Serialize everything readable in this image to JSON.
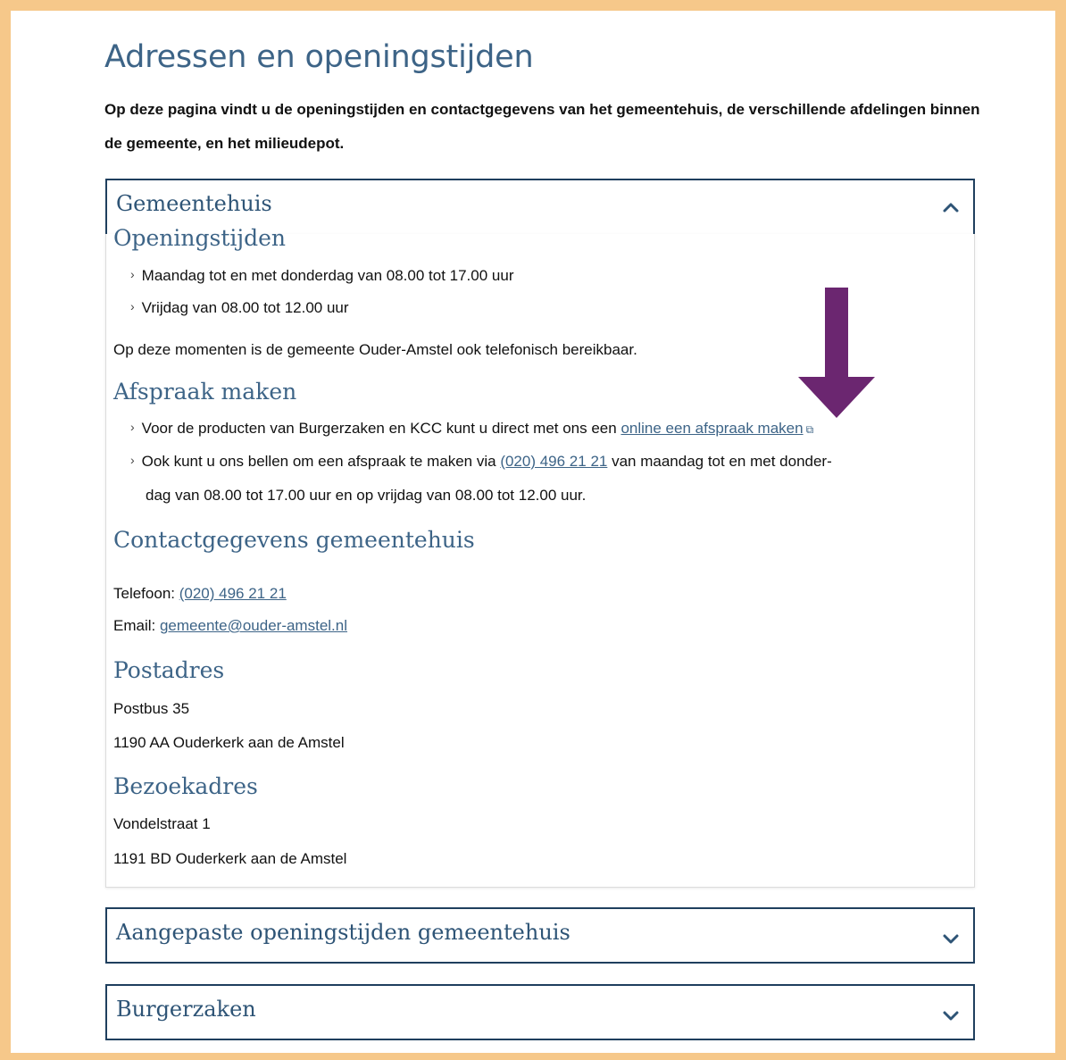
{
  "page_title": "Adressen en openingstijden",
  "intro": "Op deze pagina vindt u de openingstijden en contactgegevens van het gemeentehuis, de verschillende afdelingen binnen de gemeente, en het milieudepot.",
  "accordion_open": {
    "title": "Gemeentehuis",
    "sections": {
      "openingstijden_heading": "Openingstijden",
      "openingstijden_items": [
        "Maandag tot en met donderdag van 08.00 tot 17.00 uur",
        "Vrijdag van 08.00 tot 12.00 uur"
      ],
      "phone_note": "Op deze momenten is de gemeente Ouder-Amstel ook telefonisch bereikbaar.",
      "afspraak_heading": "Afspraak maken",
      "afspraak_item1_text": "Voor de producten van Burgerzaken en KCC kunt u direct met ons een",
      "afspraak_item1_link": "online een afspraak maken",
      "afspraak_item2_pre": "Ook kunt u ons bellen om een afspraak te maken via",
      "afspraak_item2_link": "(020) 496 21 21",
      "afspraak_item2_post": "van maandag tot en met donder-",
      "afspraak_item2_line2": "dag van 08.00 tot 17.00 uur en op vrijdag van 08.00 tot 12.00 uur.",
      "contact_heading": "Contactgegevens gemeentehuis",
      "telefoon_label": "Telefoon:",
      "telefoon_value": "(020) 496 21 21",
      "email_label": "Email:",
      "email_value": "gemeente@ouder-amstel.nl",
      "postadres_heading": "Postadres",
      "postadres_line1": "Postbus 35",
      "postadres_line2": "1190 AA Ouderkerk aan de Amstel",
      "bezoekadres_heading": "Bezoekadres",
      "bezoekadres_line1": "Vondelstraat 1",
      "bezoekadres_line2": "1191 BD Ouderkerk aan de Amstel"
    }
  },
  "accordion_closed": [
    {
      "title": "Aangepaste openingstijden gemeentehuis"
    },
    {
      "title": "Burgerzaken"
    }
  ],
  "colors": {
    "frame": "#f6c88a",
    "heading": "#3d6487",
    "border": "#1f3f5e",
    "annotation_arrow": "#6b2670"
  },
  "icons": {
    "collapse": "chevron-up-icon",
    "expand": "chevron-down-icon",
    "external": "external-link-icon",
    "annotation": "arrow-down-icon"
  }
}
